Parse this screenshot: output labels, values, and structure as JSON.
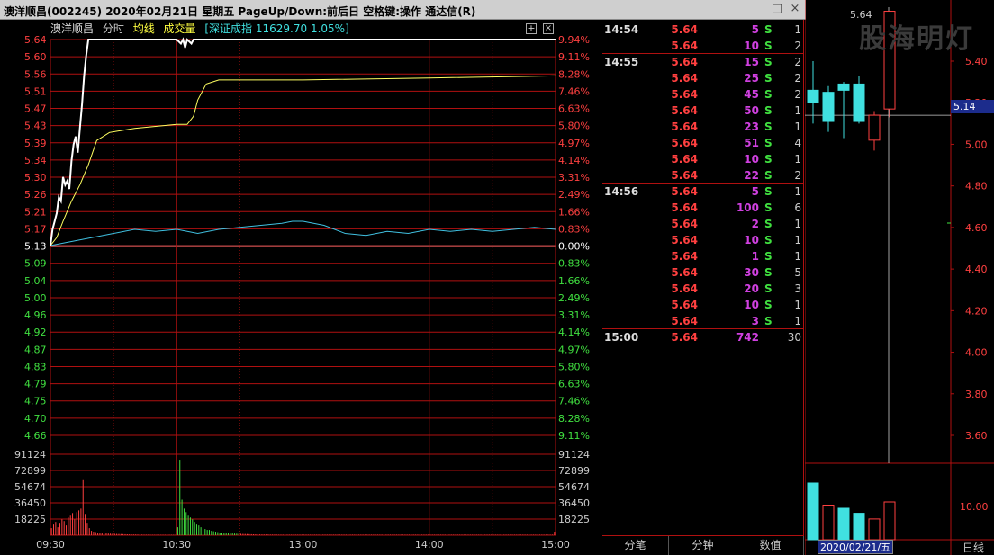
{
  "window": {
    "title": "澳洋顺昌(002245)  2020年02月21日 星期五 PageUp/Down:前后日 空格键:操作 通达信(R)",
    "restore_icon": "restore-icon",
    "close_icon": "close-icon"
  },
  "header": {
    "name": "澳洋顺昌",
    "mode": "分时",
    "ma": "均线",
    "vol": "成交量",
    "index": "[深证成指 11629.70 1.05%]",
    "plus": "+",
    "close": "×"
  },
  "colors": {
    "up": "#ff4040",
    "down": "#40e040",
    "grid": "#b01010",
    "price_line": "#ffffff",
    "avg_line": "#ffff60",
    "index_line": "#40c0e0",
    "volume": "#ff4040"
  },
  "chart_data": {
    "type": "line",
    "prev_close": 5.13,
    "price_labels": [
      "5.64",
      "5.60",
      "5.56",
      "5.51",
      "5.47",
      "5.43",
      "5.39",
      "5.34",
      "5.30",
      "5.26",
      "5.21",
      "5.17",
      "5.13",
      "5.09",
      "5.04",
      "5.00",
      "4.96",
      "4.92",
      "4.87",
      "4.83",
      "4.79",
      "4.75",
      "4.70",
      "4.66"
    ],
    "pct_labels": [
      "9.94%",
      "9.11%",
      "8.28%",
      "7.46%",
      "6.63%",
      "5.80%",
      "4.97%",
      "4.14%",
      "3.31%",
      "2.49%",
      "1.66%",
      "0.83%",
      "0.00%",
      "0.83%",
      "1.66%",
      "2.49%",
      "3.31%",
      "4.14%",
      "4.97%",
      "5.80%",
      "6.63%",
      "7.46%",
      "8.28%",
      "9.11%"
    ],
    "volume_labels": [
      "91124",
      "72899",
      "54674",
      "36450",
      "18225"
    ],
    "time_labels": [
      "09:30",
      "10:30",
      "13:00",
      "14:00",
      "15:00"
    ],
    "price_series": [
      [
        0,
        5.13
      ],
      [
        1,
        5.17
      ],
      [
        2,
        5.19
      ],
      [
        3,
        5.21
      ],
      [
        4,
        5.25
      ],
      [
        5,
        5.24
      ],
      [
        6,
        5.3
      ],
      [
        7,
        5.28
      ],
      [
        8,
        5.29
      ],
      [
        9,
        5.27
      ],
      [
        10,
        5.34
      ],
      [
        11,
        5.38
      ],
      [
        12,
        5.4
      ],
      [
        13,
        5.36
      ],
      [
        14,
        5.42
      ],
      [
        15,
        5.48
      ],
      [
        16,
        5.55
      ],
      [
        17,
        5.6
      ],
      [
        18,
        5.64
      ],
      [
        60,
        5.64
      ],
      [
        62,
        5.63
      ],
      [
        63,
        5.64
      ],
      [
        64,
        5.62
      ],
      [
        65,
        5.64
      ],
      [
        67,
        5.63
      ],
      [
        68,
        5.64
      ],
      [
        240,
        5.64
      ]
    ],
    "avg_series": [
      [
        0,
        5.13
      ],
      [
        3,
        5.15
      ],
      [
        6,
        5.19
      ],
      [
        10,
        5.24
      ],
      [
        14,
        5.28
      ],
      [
        18,
        5.33
      ],
      [
        22,
        5.39
      ],
      [
        28,
        5.41
      ],
      [
        40,
        5.42
      ],
      [
        60,
        5.43
      ],
      [
        65,
        5.43
      ],
      [
        68,
        5.45
      ],
      [
        70,
        5.49
      ],
      [
        74,
        5.53
      ],
      [
        80,
        5.54
      ],
      [
        120,
        5.54
      ],
      [
        180,
        5.545
      ],
      [
        240,
        5.55
      ]
    ],
    "index_series": [
      [
        0,
        5.13
      ],
      [
        10,
        5.14
      ],
      [
        20,
        5.15
      ],
      [
        30,
        5.16
      ],
      [
        40,
        5.17
      ],
      [
        50,
        5.165
      ],
      [
        60,
        5.17
      ],
      [
        70,
        5.16
      ],
      [
        80,
        5.17
      ],
      [
        90,
        5.175
      ],
      [
        100,
        5.18
      ],
      [
        110,
        5.185
      ],
      [
        115,
        5.19
      ],
      [
        120,
        5.19
      ],
      [
        125,
        5.185
      ],
      [
        130,
        5.18
      ],
      [
        135,
        5.17
      ],
      [
        140,
        5.16
      ],
      [
        150,
        5.155
      ],
      [
        160,
        5.165
      ],
      [
        170,
        5.16
      ],
      [
        180,
        5.17
      ],
      [
        190,
        5.165
      ],
      [
        200,
        5.17
      ],
      [
        210,
        5.165
      ],
      [
        220,
        5.17
      ],
      [
        230,
        5.175
      ],
      [
        240,
        5.17
      ]
    ],
    "volume_series": [
      8000,
      12000,
      15000,
      9000,
      14000,
      18000,
      16000,
      11000,
      20000,
      22000,
      25000,
      18000,
      26000,
      28000,
      30000,
      62000,
      24000,
      14000,
      8000,
      5000,
      4000,
      3500,
      3000,
      2800,
      2500,
      2300,
      2000,
      1900,
      1800,
      1700,
      1600,
      1500,
      1400,
      1300,
      1200,
      1100,
      1000,
      900,
      900,
      800,
      800,
      700,
      700,
      700,
      600,
      600,
      600,
      500,
      500,
      500,
      500,
      500,
      500,
      500,
      500,
      500,
      500,
      500,
      500,
      500,
      9000,
      85000,
      40000,
      30000,
      26000,
      22000,
      20000,
      18000,
      15000,
      12000,
      11000,
      9000,
      8000,
      7000,
      6000,
      6000,
      5000,
      4500,
      4000,
      3500,
      3000,
      3000,
      2800,
      2600,
      2400,
      2200,
      2000,
      1900,
      1800,
      1700,
      1600,
      1500,
      1400,
      1300,
      1200,
      1100,
      1000,
      950,
      900,
      850,
      800,
      800,
      800,
      750,
      700,
      700,
      700,
      650,
      600,
      600,
      600,
      600,
      600,
      600,
      600,
      600,
      600,
      600,
      600,
      600,
      600,
      600,
      600,
      600,
      600,
      600,
      600,
      600,
      600,
      600,
      600,
      600,
      600,
      600,
      600,
      600,
      600,
      600,
      600,
      600,
      600,
      600,
      600,
      600,
      600,
      600,
      600,
      600,
      600,
      600,
      600,
      600,
      600,
      600,
      600,
      600,
      600,
      600,
      600,
      600,
      600,
      600,
      600,
      600,
      600,
      600,
      600,
      600,
      600,
      600,
      600,
      600,
      600,
      600,
      600,
      600,
      600,
      600,
      600,
      600,
      600,
      600,
      600,
      600,
      600,
      600,
      600,
      600,
      600,
      600,
      600,
      600,
      600,
      600,
      600,
      600,
      600,
      600,
      600,
      600,
      600,
      600,
      600,
      600,
      600,
      600,
      600,
      600,
      600,
      600,
      600,
      600,
      600,
      600,
      600,
      600,
      600,
      600,
      600,
      600,
      600,
      600,
      600,
      600,
      600,
      600,
      600,
      600,
      600,
      600,
      600,
      600,
      600,
      600,
      600,
      600,
      600,
      600,
      600,
      4000
    ]
  },
  "ticks": [
    {
      "time": "14:54",
      "price": "5.64",
      "vol": "5",
      "bs": "S",
      "cnt": "1"
    },
    {
      "time": "",
      "price": "5.64",
      "vol": "10",
      "bs": "S",
      "cnt": "2"
    },
    {
      "time": "14:55",
      "price": "5.64",
      "vol": "15",
      "bs": "S",
      "cnt": "2"
    },
    {
      "time": "",
      "price": "5.64",
      "vol": "25",
      "bs": "S",
      "cnt": "2"
    },
    {
      "time": "",
      "price": "5.64",
      "vol": "45",
      "bs": "S",
      "cnt": "2"
    },
    {
      "time": "",
      "price": "5.64",
      "vol": "50",
      "bs": "S",
      "cnt": "1"
    },
    {
      "time": "",
      "price": "5.64",
      "vol": "23",
      "bs": "S",
      "cnt": "1"
    },
    {
      "time": "",
      "price": "5.64",
      "vol": "51",
      "bs": "S",
      "cnt": "4"
    },
    {
      "time": "",
      "price": "5.64",
      "vol": "10",
      "bs": "S",
      "cnt": "1"
    },
    {
      "time": "",
      "price": "5.64",
      "vol": "22",
      "bs": "S",
      "cnt": "2"
    },
    {
      "time": "14:56",
      "price": "5.64",
      "vol": "5",
      "bs": "S",
      "cnt": "1"
    },
    {
      "time": "",
      "price": "5.64",
      "vol": "100",
      "bs": "S",
      "cnt": "6"
    },
    {
      "time": "",
      "price": "5.64",
      "vol": "2",
      "bs": "S",
      "cnt": "1"
    },
    {
      "time": "",
      "price": "5.64",
      "vol": "10",
      "bs": "S",
      "cnt": "1"
    },
    {
      "time": "",
      "price": "5.64",
      "vol": "1",
      "bs": "S",
      "cnt": "1"
    },
    {
      "time": "",
      "price": "5.64",
      "vol": "30",
      "bs": "S",
      "cnt": "5"
    },
    {
      "time": "",
      "price": "5.64",
      "vol": "20",
      "bs": "S",
      "cnt": "3"
    },
    {
      "time": "",
      "price": "5.64",
      "vol": "10",
      "bs": "S",
      "cnt": "1"
    },
    {
      "time": "",
      "price": "5.64",
      "vol": "3",
      "bs": "S",
      "cnt": "1"
    },
    {
      "time": "15:00",
      "price": "5.64",
      "vol": "742",
      "bs": "",
      "cnt": "30"
    }
  ],
  "tick_tabs": [
    "分笔",
    "分钟",
    "数值"
  ],
  "kline": {
    "watermark": "股海明灯",
    "hi_label": "5.64",
    "price_tag": "5.14",
    "date": "2020/02/21/五",
    "tab": "日线",
    "axis_labels": [
      "5.40",
      "5.20",
      "5.00",
      "4.80",
      "4.60",
      "4.40",
      "4.20",
      "4.00",
      "3.80",
      "3.60"
    ],
    "vol_label": "10.00",
    "candles": [
      {
        "open": 5.2,
        "close": 5.26,
        "high": 5.4,
        "low": 5.1,
        "color": "#40e0e0"
      },
      {
        "open": 5.25,
        "close": 5.11,
        "high": 5.28,
        "low": 5.06,
        "color": "#40e0e0"
      },
      {
        "open": 5.26,
        "close": 5.29,
        "high": 5.3,
        "low": 5.03,
        "color": "#40e0e0"
      },
      {
        "open": 5.29,
        "close": 5.11,
        "high": 5.33,
        "low": 5.1,
        "color": "#40e0e0"
      },
      {
        "open": 5.02,
        "close": 5.14,
        "high": 5.16,
        "low": 4.97,
        "color": "#ff4040"
      },
      {
        "open": 5.17,
        "close": 5.64,
        "high": 5.64,
        "low": 5.13,
        "color": "#ff4040"
      }
    ],
    "volumes": [
      {
        "v": 0.9,
        "color": "#40e0e0"
      },
      {
        "v": 0.55,
        "color": "#ff4040"
      },
      {
        "v": 0.5,
        "color": "#40e0e0"
      },
      {
        "v": 0.42,
        "color": "#40e0e0"
      },
      {
        "v": 0.33,
        "color": "#ff4040"
      },
      {
        "v": 0.6,
        "color": "#ff4040"
      }
    ]
  }
}
